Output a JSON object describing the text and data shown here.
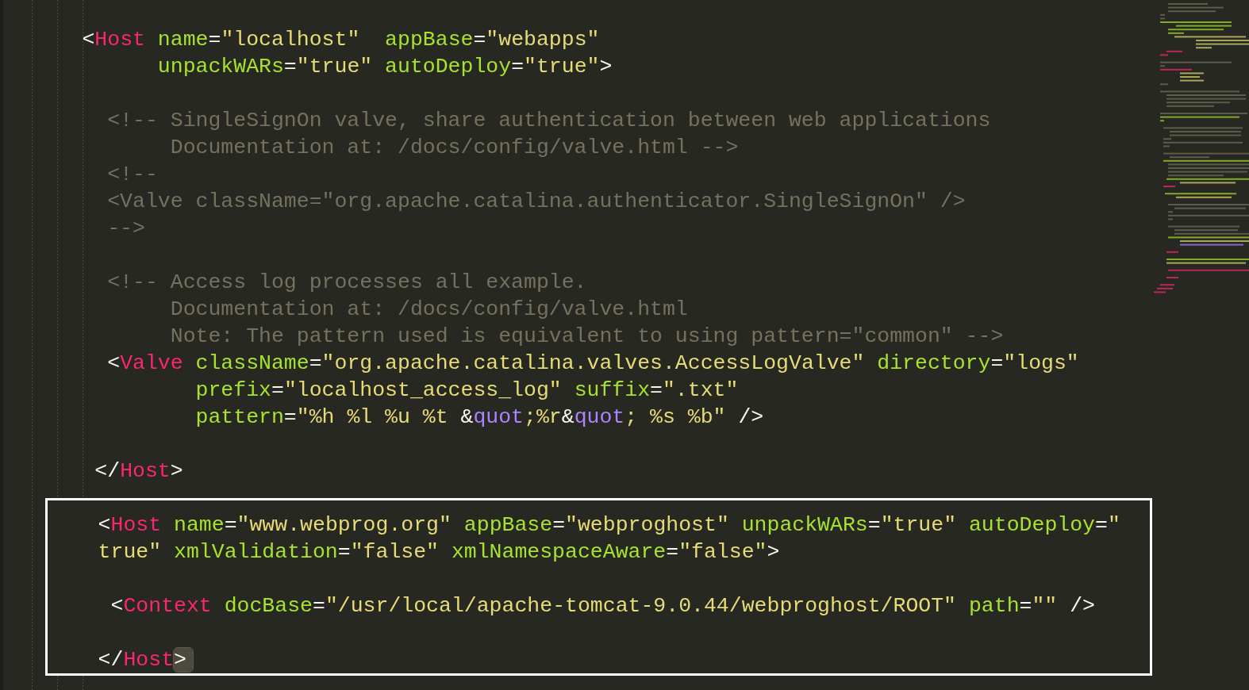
{
  "editor": {
    "blocks": [
      {
        "framed": false,
        "lines": [
          {
            "tokens": [
              {
                "kind": "punct",
                "text": "      <"
              },
              {
                "kind": "tag",
                "text": "Host"
              },
              {
                "kind": "attr",
                "text": " name"
              },
              {
                "kind": "punct",
                "text": "="
              },
              {
                "kind": "string",
                "text": "\"localhost\""
              },
              {
                "kind": "attr",
                "text": "  appBase"
              },
              {
                "kind": "punct",
                "text": "="
              },
              {
                "kind": "string",
                "text": "\"webapps\""
              }
            ]
          },
          {
            "tokens": [
              {
                "kind": "attr",
                "text": "            unpackWARs"
              },
              {
                "kind": "punct",
                "text": "="
              },
              {
                "kind": "string",
                "text": "\"true\""
              },
              {
                "kind": "attr",
                "text": " autoDeploy"
              },
              {
                "kind": "punct",
                "text": "="
              },
              {
                "kind": "string",
                "text": "\"true\""
              },
              {
                "kind": "punct",
                "text": ">"
              }
            ]
          },
          {
            "blank_before": true,
            "tokens": [
              {
                "kind": "comment",
                "text": "        <!-- SingleSignOn valve, share authentication between web applications"
              }
            ]
          },
          {
            "tokens": [
              {
                "kind": "comment",
                "text": "             Documentation at: /docs/config/valve.html -->"
              }
            ]
          },
          {
            "tokens": [
              {
                "kind": "comment",
                "text": "        <!--"
              }
            ]
          },
          {
            "tokens": [
              {
                "kind": "comment",
                "text": "        <Valve className=\"org.apache.catalina.authenticator.SingleSignOn\" />"
              }
            ]
          },
          {
            "tokens": [
              {
                "kind": "comment",
                "text": "        -->"
              }
            ]
          },
          {
            "blank_before": true,
            "tokens": [
              {
                "kind": "comment",
                "text": "        <!-- Access log processes all example."
              }
            ]
          },
          {
            "tokens": [
              {
                "kind": "comment",
                "text": "             Documentation at: /docs/config/valve.html"
              }
            ]
          },
          {
            "tokens": [
              {
                "kind": "comment",
                "text": "             Note: The pattern used is equivalent to using pattern=\"common\" -->"
              }
            ]
          },
          {
            "tokens": [
              {
                "kind": "punct",
                "text": "        <"
              },
              {
                "kind": "tag",
                "text": "Valve"
              },
              {
                "kind": "attr",
                "text": " className"
              },
              {
                "kind": "punct",
                "text": "="
              },
              {
                "kind": "string",
                "text": "\"org.apache.catalina.valves.AccessLogValve\""
              },
              {
                "kind": "attr",
                "text": " directory"
              },
              {
                "kind": "punct",
                "text": "="
              },
              {
                "kind": "string",
                "text": "\"logs\""
              }
            ]
          },
          {
            "tokens": [
              {
                "kind": "attr",
                "text": "               prefix"
              },
              {
                "kind": "punct",
                "text": "="
              },
              {
                "kind": "string",
                "text": "\"localhost_access_log\""
              },
              {
                "kind": "attr",
                "text": " suffix"
              },
              {
                "kind": "punct",
                "text": "="
              },
              {
                "kind": "string",
                "text": "\".txt\""
              }
            ]
          },
          {
            "tokens": [
              {
                "kind": "attr",
                "text": "               pattern"
              },
              {
                "kind": "punct",
                "text": "="
              },
              {
                "kind": "string",
                "text": "\"%h %l %u %t "
              },
              {
                "kind": "punct",
                "text": "&"
              },
              {
                "kind": "entity",
                "text": "quot"
              },
              {
                "kind": "string",
                "text": ";%r"
              },
              {
                "kind": "punct",
                "text": "&"
              },
              {
                "kind": "entity",
                "text": "quot"
              },
              {
                "kind": "string",
                "text": "; %s %b\""
              },
              {
                "kind": "punct",
                "text": " />"
              }
            ]
          },
          {
            "blank_before": true,
            "tokens": [
              {
                "kind": "punct",
                "text": "       </"
              },
              {
                "kind": "tag",
                "text": "Host"
              },
              {
                "kind": "punct",
                "text": ">"
              }
            ]
          }
        ]
      },
      {
        "framed": true,
        "lines": [
          {
            "tokens": [
              {
                "kind": "punct",
                "text": "    <"
              },
              {
                "kind": "tag",
                "text": "Host"
              },
              {
                "kind": "attr",
                "text": " name"
              },
              {
                "kind": "punct",
                "text": "="
              },
              {
                "kind": "string",
                "text": "\"www.webprog.org\""
              },
              {
                "kind": "attr",
                "text": " appBase"
              },
              {
                "kind": "punct",
                "text": "="
              },
              {
                "kind": "string",
                "text": "\"webproghost\""
              },
              {
                "kind": "attr",
                "text": " unpackWARs"
              },
              {
                "kind": "punct",
                "text": "="
              },
              {
                "kind": "string",
                "text": "\"true\""
              },
              {
                "kind": "attr",
                "text": " autoDeploy"
              },
              {
                "kind": "punct",
                "text": "="
              },
              {
                "kind": "string",
                "text": "\""
              }
            ]
          },
          {
            "tokens": [
              {
                "kind": "string",
                "text": "    true\""
              },
              {
                "kind": "attr",
                "text": " xmlValidation"
              },
              {
                "kind": "punct",
                "text": "="
              },
              {
                "kind": "string",
                "text": "\"false\""
              },
              {
                "kind": "attr",
                "text": " xmlNamespaceAware"
              },
              {
                "kind": "punct",
                "text": "="
              },
              {
                "kind": "string",
                "text": "\"false\""
              },
              {
                "kind": "punct",
                "text": ">"
              }
            ]
          },
          {
            "blank_before": true,
            "tokens": [
              {
                "kind": "punct",
                "text": "     <"
              },
              {
                "kind": "tag",
                "text": "Context"
              },
              {
                "kind": "attr",
                "text": " docBase"
              },
              {
                "kind": "punct",
                "text": "="
              },
              {
                "kind": "string",
                "text": "\"/usr/local/apache-tomcat-9.0.44/webproghost/ROOT\""
              },
              {
                "kind": "attr",
                "text": " path"
              },
              {
                "kind": "punct",
                "text": "="
              },
              {
                "kind": "string",
                "text": "\"\""
              },
              {
                "kind": "punct",
                "text": " />"
              }
            ]
          },
          {
            "blank_before": true,
            "tokens": [
              {
                "kind": "punct",
                "text": "    </"
              },
              {
                "kind": "tag",
                "text": "Host"
              },
              {
                "kind": "bracket-match",
                "text": ">"
              }
            ]
          }
        ]
      }
    ]
  }
}
